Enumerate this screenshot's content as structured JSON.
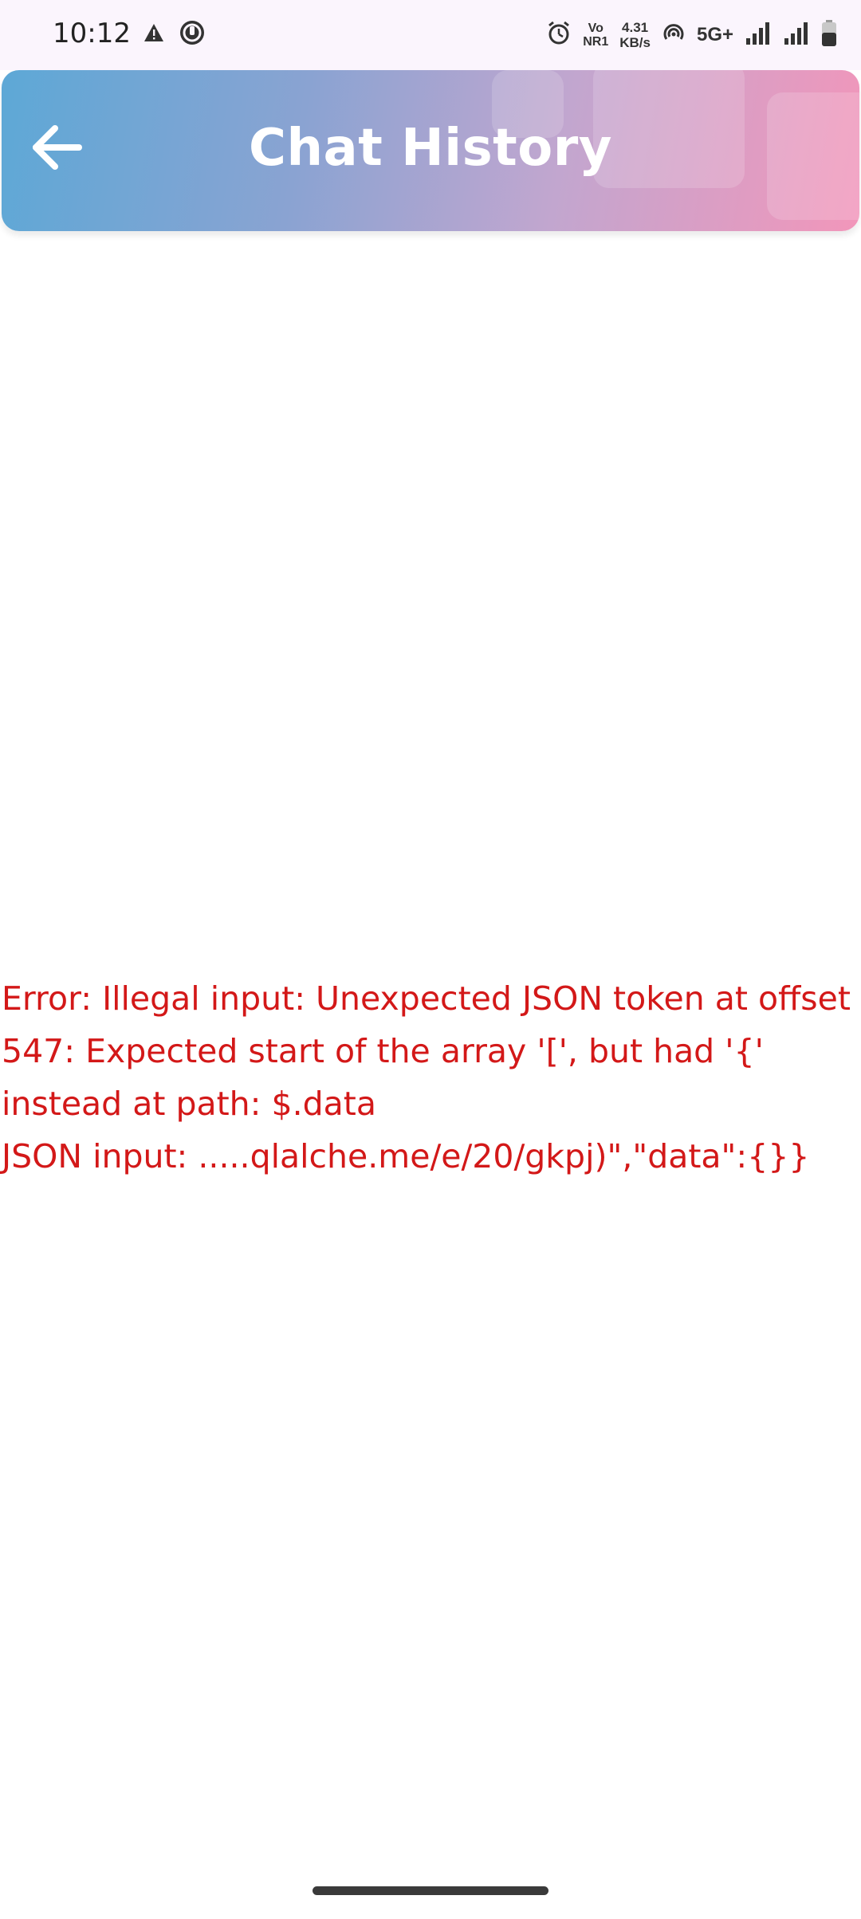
{
  "status_bar": {
    "time": "10:12",
    "icons_left": [
      "warning-icon",
      "phone-sync-icon"
    ],
    "vo_top": "Vo",
    "vo_bottom": "NR1",
    "speed_value": "4.31",
    "speed_unit": "KB/s",
    "network_type": "5G+",
    "icons_right": [
      "alarm-icon",
      "hotspot-icon",
      "signal-icon",
      "signal-icon",
      "battery-icon"
    ]
  },
  "app_bar": {
    "title": "Chat History",
    "back_icon": "arrow-left-icon",
    "gradient_start": "#5da8d6",
    "gradient_end": "#f296ba"
  },
  "error": {
    "color": "#d31818",
    "message": "Error: Illegal input: Unexpected JSON token at offset 547: Expected start of the array '[', but had '{' instead at path: $.data\nJSON input: .....qlalche.me/e/20/gkpj)\",\"data\":{}}"
  }
}
